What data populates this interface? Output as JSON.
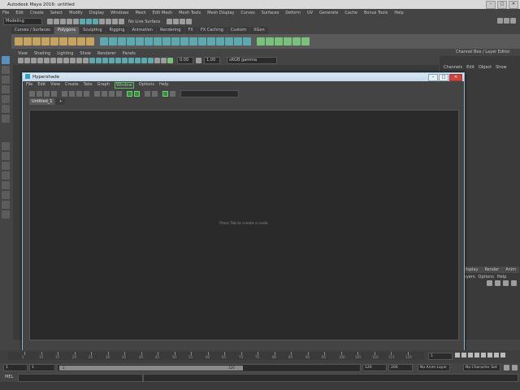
{
  "app": {
    "title": "Autodesk Maya 2016: untitled"
  },
  "main_menu": [
    "File",
    "Edit",
    "Create",
    "Select",
    "Modify",
    "Display",
    "Windows",
    "Mesh",
    "Edit Mesh",
    "Mesh Tools",
    "Mesh Display",
    "Curves",
    "Surfaces",
    "Deform",
    "UV",
    "Generate",
    "Cache",
    "Bonus Tools",
    "Help"
  ],
  "status_line": {
    "menuset": "Modeling",
    "live_surface": "No Live Surface"
  },
  "shelf_tabs": [
    "Curves / Surfaces",
    "Polygons",
    "Sculpting",
    "Rigging",
    "Animation",
    "Rendering",
    "FX",
    "FX Caching",
    "Custom",
    "XGen"
  ],
  "active_shelf_tab": "Polygons",
  "viewport": {
    "menu": [
      "View",
      "Shading",
      "Lighting",
      "Show",
      "Renderer",
      "Panels"
    ],
    "near": "0.00",
    "far": "1.00",
    "color_space": "sRGB gamma"
  },
  "channel_box": {
    "header": "Channel Box / Layer Editor",
    "menu": [
      "Channels",
      "Edit",
      "Object",
      "Show"
    ]
  },
  "layer_editor": {
    "tabs": [
      "Display",
      "Render",
      "Anim"
    ],
    "menu": [
      "Layers",
      "Options",
      "Help"
    ]
  },
  "hypershade": {
    "title": "Hypershade",
    "menu": [
      "File",
      "Edit",
      "View",
      "Create",
      "Tabs",
      "Graph",
      "Window",
      "Options",
      "Help"
    ],
    "highlighted_menu": "Window",
    "tab_label": "Untitled_1",
    "add_tab": "+",
    "hint": "Press Tab to create a node.",
    "window_buttons": [
      "–",
      "□",
      "✕"
    ]
  },
  "timeline": {
    "ticks": [
      "5",
      "10",
      "15",
      "20",
      "25",
      "30",
      "35",
      "40",
      "45",
      "50",
      "55",
      "60",
      "65",
      "70",
      "75",
      "80",
      "85",
      "90",
      "95",
      "100",
      "105",
      "110",
      "115",
      "120"
    ],
    "current_frame": "1"
  },
  "range": {
    "start": "1",
    "playback_start": "1",
    "slider_start": "1",
    "slider_end": "120",
    "playback_end": "120",
    "end": "200",
    "anim_layer": "No Anim Layer",
    "character_set": "No Character Set"
  },
  "command_line": {
    "label": "MEL"
  },
  "colors": {
    "accent_teal": "#5ea9b0",
    "highlight_green": "#58c25e",
    "hypershade_border": "#8fb8d6"
  }
}
